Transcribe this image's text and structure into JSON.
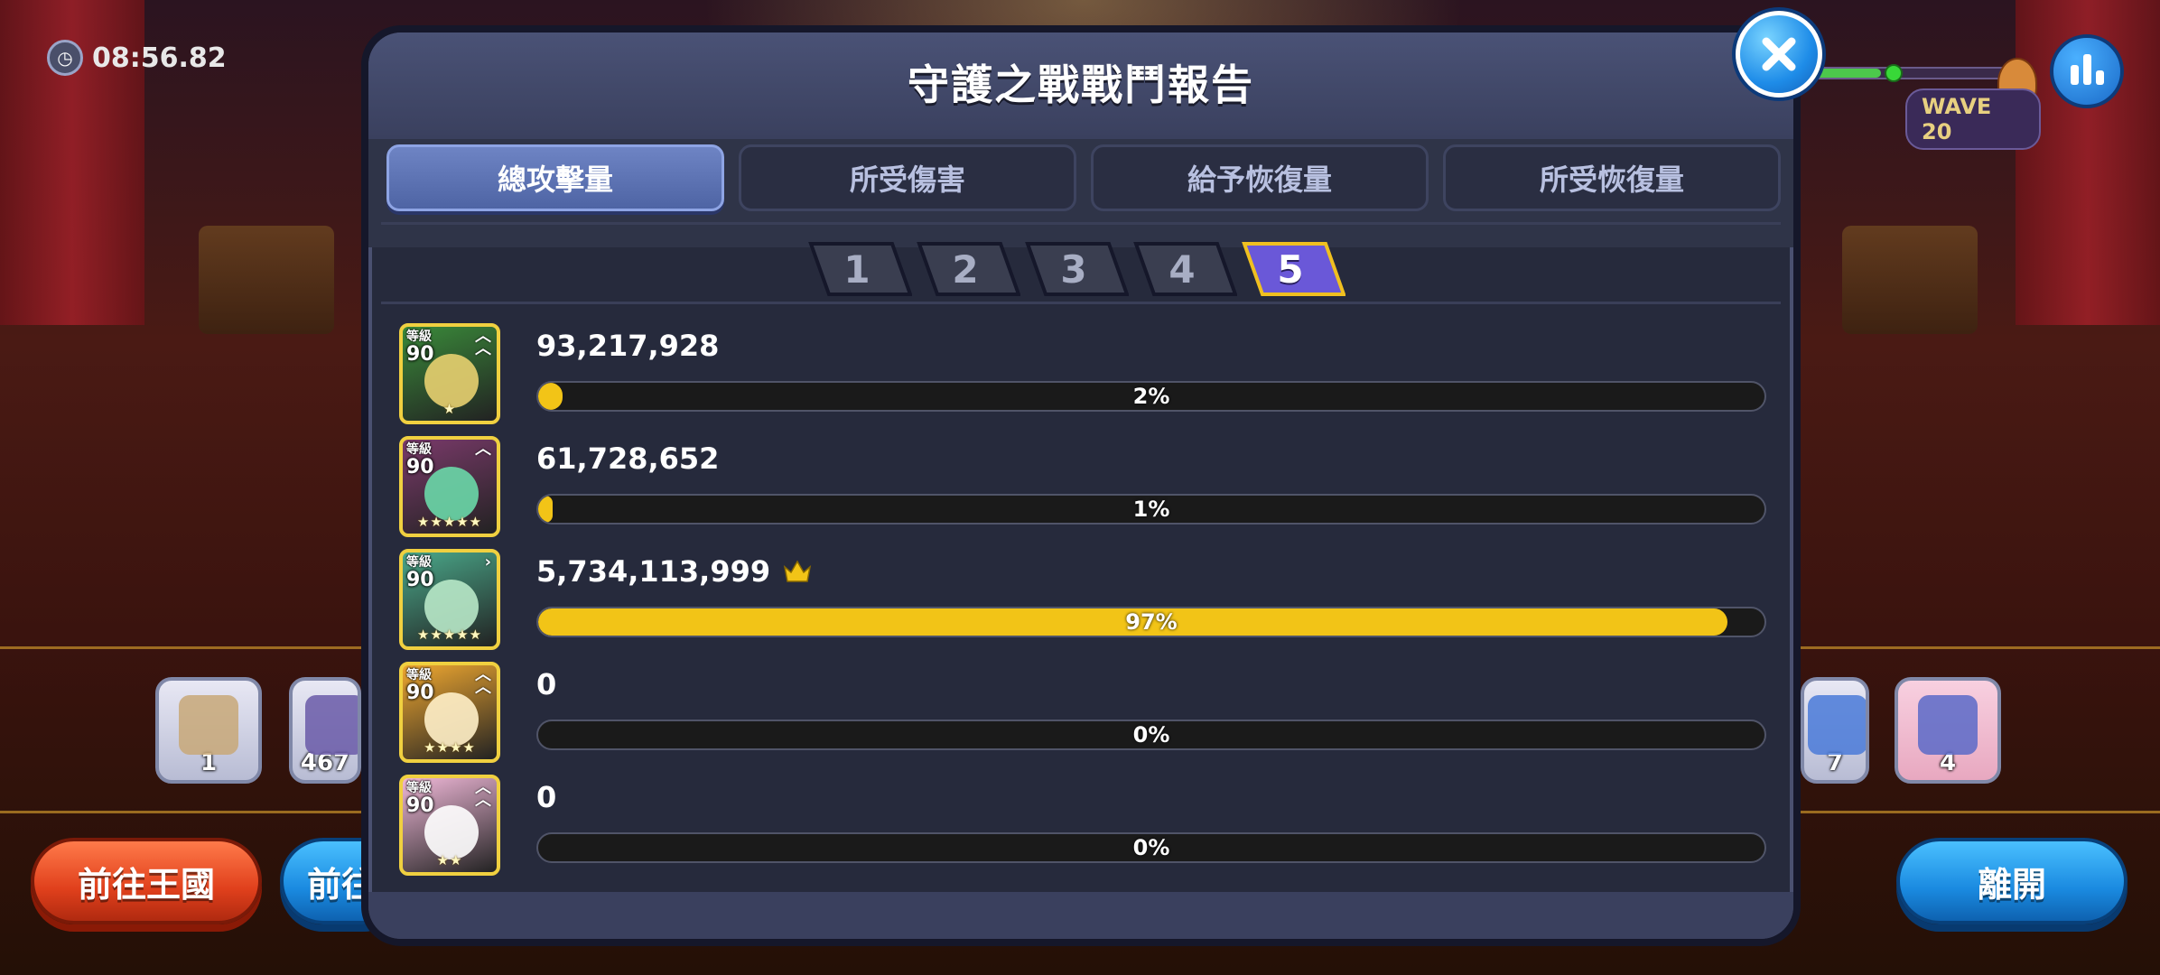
{
  "hud": {
    "timer": "08:56.82",
    "wave_label": "WAVE 20",
    "wave_progress": 0.35
  },
  "background": {
    "item_slots": [
      {
        "count": "1"
      },
      {
        "count": "467"
      },
      {
        "count": "7"
      },
      {
        "count": "4"
      }
    ],
    "buttons": {
      "kingdom": "前往王國",
      "partial": "前往",
      "leave": "離開"
    }
  },
  "report": {
    "title": "守護之戰戰鬥報告",
    "tabs": [
      {
        "label": "總攻擊量",
        "active": true
      },
      {
        "label": "所受傷害",
        "active": false
      },
      {
        "label": "給予恢復量",
        "active": false
      },
      {
        "label": "所受恢復量",
        "active": false
      }
    ],
    "pages": [
      "1",
      "2",
      "3",
      "4",
      "5"
    ],
    "active_page": "5",
    "level_caption": "等級",
    "rows": [
      {
        "level": "90",
        "value": "93,217,928",
        "percent_label": "2%",
        "percent": 2,
        "stars": "★",
        "top": false,
        "color": "#3a8a3a"
      },
      {
        "level": "90",
        "value": "61,728,652",
        "percent_label": "1%",
        "percent": 1,
        "stars": "★★★★★",
        "top": false,
        "color": "#7a3a6a"
      },
      {
        "level": "90",
        "value": "5,734,113,999",
        "percent_label": "97%",
        "percent": 97,
        "stars": "★★★★★",
        "top": true,
        "color": "#4aa88a"
      },
      {
        "level": "90",
        "value": "0",
        "percent_label": "0%",
        "percent": 0,
        "stars": "★★★★",
        "top": false,
        "color": "#f0a830"
      },
      {
        "level": "90",
        "value": "0",
        "percent_label": "0%",
        "percent": 0,
        "stars": "★★",
        "top": false,
        "color": "#f0b8d8"
      }
    ]
  },
  "colors": {
    "accent_yellow": "#f2c417",
    "panel": "#262a3c",
    "tab_active": "#5a70b0",
    "page_active": "#6a58d8"
  }
}
